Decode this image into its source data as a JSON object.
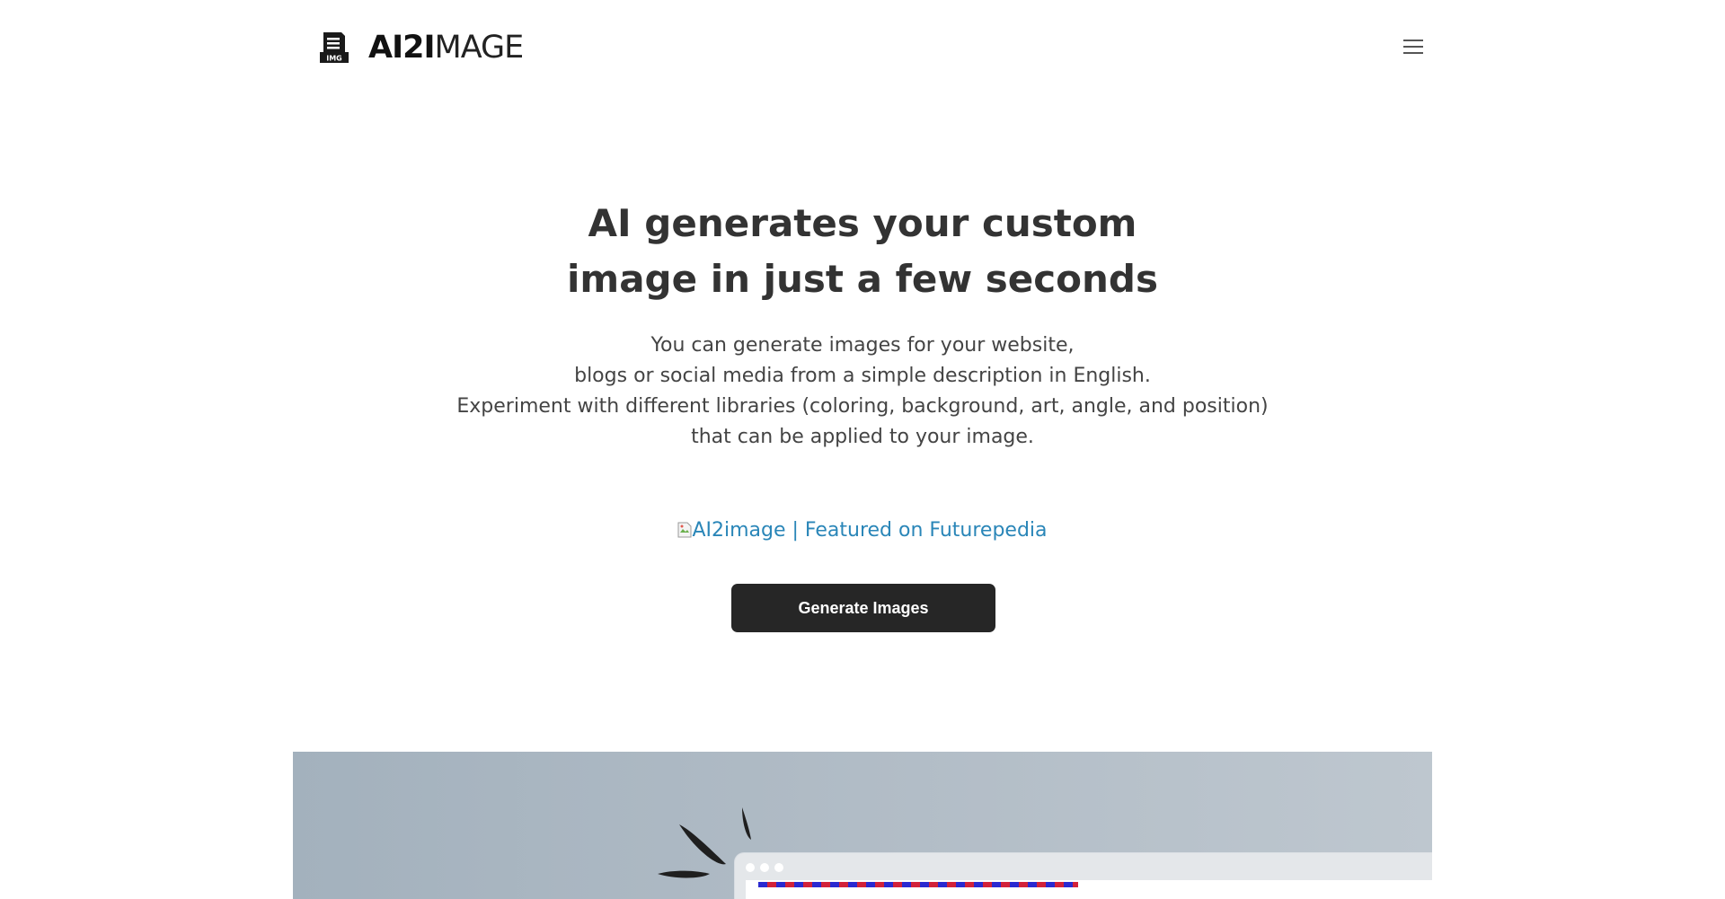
{
  "header": {
    "logo": {
      "icon": "document-img-icon",
      "icon_badge": "IMG",
      "text_bold": "AI2I",
      "text_light": "MAGE"
    },
    "menu_icon": "hamburger-menu-icon"
  },
  "hero": {
    "title_lines": [
      "AI generates your custom",
      "image in just a few seconds"
    ],
    "description_lines": [
      "You can generate images for your website,",
      "blogs or social media from a simple description in English.",
      "Experiment with different libraries (coloring, background, art, angle, and position)",
      "that can be applied to your image."
    ],
    "featured_link_text": "AI2image | Featured on Futurepedia",
    "generate_button_label": "Generate Images"
  },
  "colors": {
    "link": "#2a86b8",
    "button_bg": "#262626",
    "button_text": "#ffffff",
    "heading": "#333333",
    "preview_bg": "#aab6c2"
  }
}
